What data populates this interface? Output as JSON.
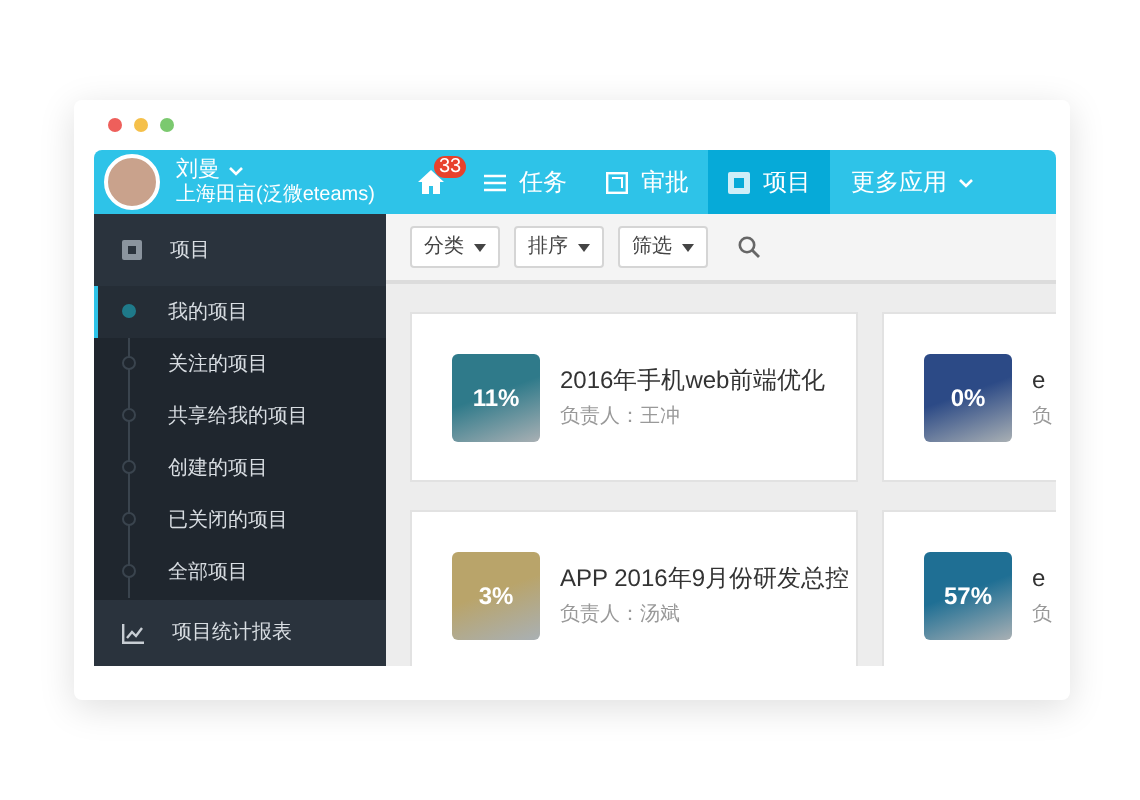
{
  "window": {
    "controls": [
      {
        "color": "#ee5f5b"
      },
      {
        "color": "#f5c04a"
      },
      {
        "color": "#7bc96f"
      }
    ]
  },
  "user": {
    "name": "刘曼",
    "org": "上海田亩(泛微eteams)"
  },
  "nav": {
    "home_badge": "33",
    "tabs": [
      {
        "label": "任务",
        "selected": false,
        "caret": false
      },
      {
        "label": "审批",
        "selected": false,
        "caret": false
      },
      {
        "label": "项目",
        "selected": true,
        "caret": false
      },
      {
        "label": "更多应用",
        "selected": false,
        "caret": true
      }
    ]
  },
  "sidebar": {
    "section": {
      "label": "项目"
    },
    "items": [
      {
        "label": "我的项目",
        "selected": true
      },
      {
        "label": "关注的项目",
        "selected": false
      },
      {
        "label": "共享给我的项目",
        "selected": false
      },
      {
        "label": "创建的项目",
        "selected": false
      },
      {
        "label": "已关闭的项目",
        "selected": false
      },
      {
        "label": "全部项目",
        "selected": false
      }
    ],
    "footer": {
      "label": "项目统计报表"
    }
  },
  "toolbar": {
    "filters": [
      "分类",
      "排序",
      "筛选"
    ]
  },
  "projects": [
    {
      "title": "2016年手机web前端优化",
      "owner": "负责人：王冲",
      "progress": "11%",
      "color": "#2f7a8a"
    },
    {
      "title": "e",
      "owner": "负",
      "progress": "0%",
      "color": "#2c4a86"
    },
    {
      "title": "APP 2016年9月份研发总控",
      "owner": "负责人：汤斌",
      "progress": "3%",
      "color": "#b9a46a"
    },
    {
      "title": "e",
      "owner": "负",
      "progress": "57%",
      "color": "#1f6f94"
    }
  ]
}
